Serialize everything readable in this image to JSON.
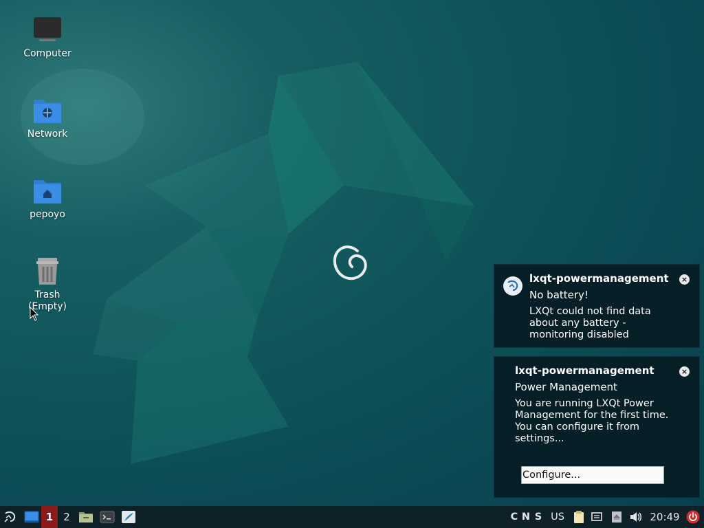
{
  "desktop": {
    "icons": [
      {
        "label": "Computer",
        "icon": "monitor-icon"
      },
      {
        "label": "Network",
        "icon": "network-folder-icon"
      },
      {
        "label": "pepoyo",
        "icon": "home-folder-icon"
      },
      {
        "label": "Trash\n(Empty)",
        "icon": "trash-icon"
      }
    ]
  },
  "notifications": [
    {
      "title": "lxqt-powermanagement",
      "subtitle": "No battery!",
      "body": "LXQt could not find data about any battery - monitoring disabled",
      "icon": "lxqt-logo-icon"
    },
    {
      "title": "lxqt-powermanagement",
      "subtitle": "Power Management",
      "body": "You are running LXQt Power Management for the first time.\nYou can configure it from settings...",
      "button_label": "Configure..."
    }
  ],
  "taskbar": {
    "workspaces": [
      "1",
      "2"
    ],
    "tray": {
      "indicators": [
        "C",
        "N",
        "S"
      ],
      "keyboard_layout": "US",
      "clock": "20:49"
    }
  },
  "colors": {
    "taskbar_bg": "#0e2028",
    "workspace_active": "#8b1a1a",
    "notification_bg": "#061e26",
    "power_button": "#d42b2b",
    "folder_blue": "#3a8ee6"
  }
}
